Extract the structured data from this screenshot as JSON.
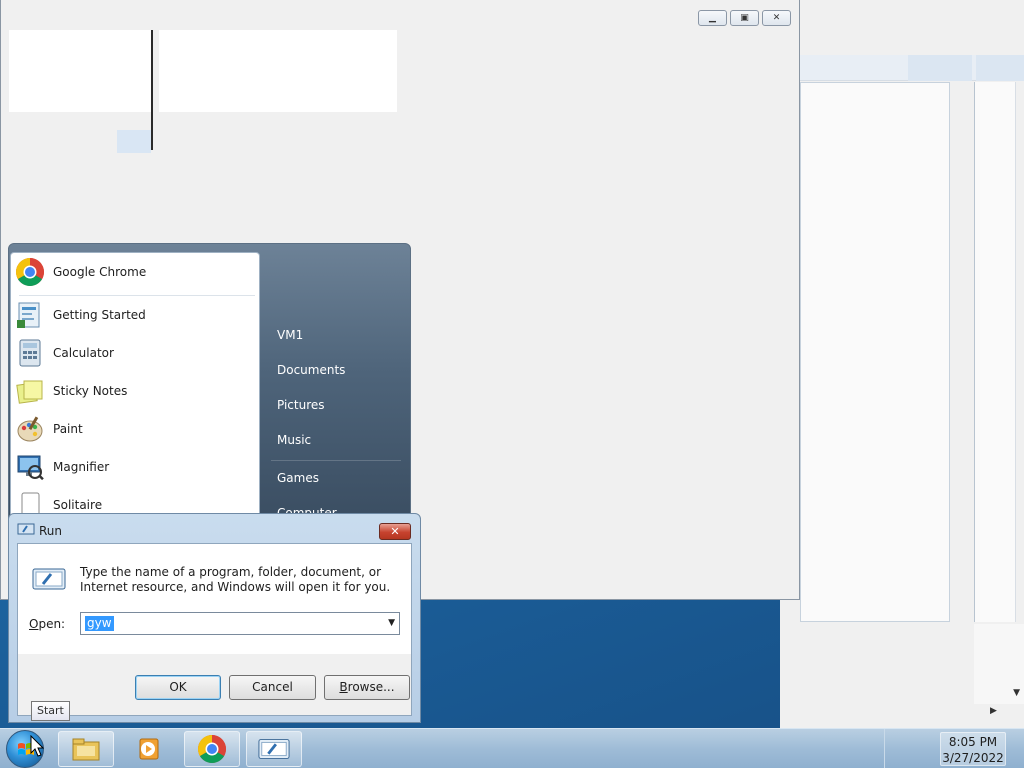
{
  "start_menu": {
    "pinned": [
      {
        "label": "Google Chrome",
        "icon": "chrome-icon"
      }
    ],
    "recent": [
      {
        "label": "Getting Started",
        "icon": "getting-started-icon"
      },
      {
        "label": "Calculator",
        "icon": "calculator-icon"
      },
      {
        "label": "Sticky Notes",
        "icon": "sticky-notes-icon"
      },
      {
        "label": "Paint",
        "icon": "paint-icon"
      },
      {
        "label": "Magnifier",
        "icon": "magnifier-icon"
      },
      {
        "label": "Solitaire",
        "icon": "solitaire-icon"
      }
    ],
    "right_links": [
      "VM1",
      "Documents",
      "Pictures",
      "Music",
      "Games",
      "Computer"
    ]
  },
  "run_dialog": {
    "title": "Run",
    "message": "Type the name of a program, folder, document, or Internet resource, and Windows will open it for you.",
    "open_label_underlined": "O",
    "open_label_rest": "pen:",
    "input_value": "gyw",
    "ok_label": "OK",
    "cancel_label": "Cancel",
    "browse_label_underlined": "B",
    "browse_label_rest": "rowse..."
  },
  "tooltip": {
    "text": "Start"
  },
  "taskbar": {
    "time": "8:05 PM",
    "date": "3/27/2022",
    "buttons": [
      "explorer-icon",
      "media-player-icon",
      "chrome-icon",
      "run-icon"
    ]
  },
  "colors": {
    "selection": "#3399ff",
    "taskbar": "#9fbcd7",
    "close_button": "#c7432f"
  }
}
